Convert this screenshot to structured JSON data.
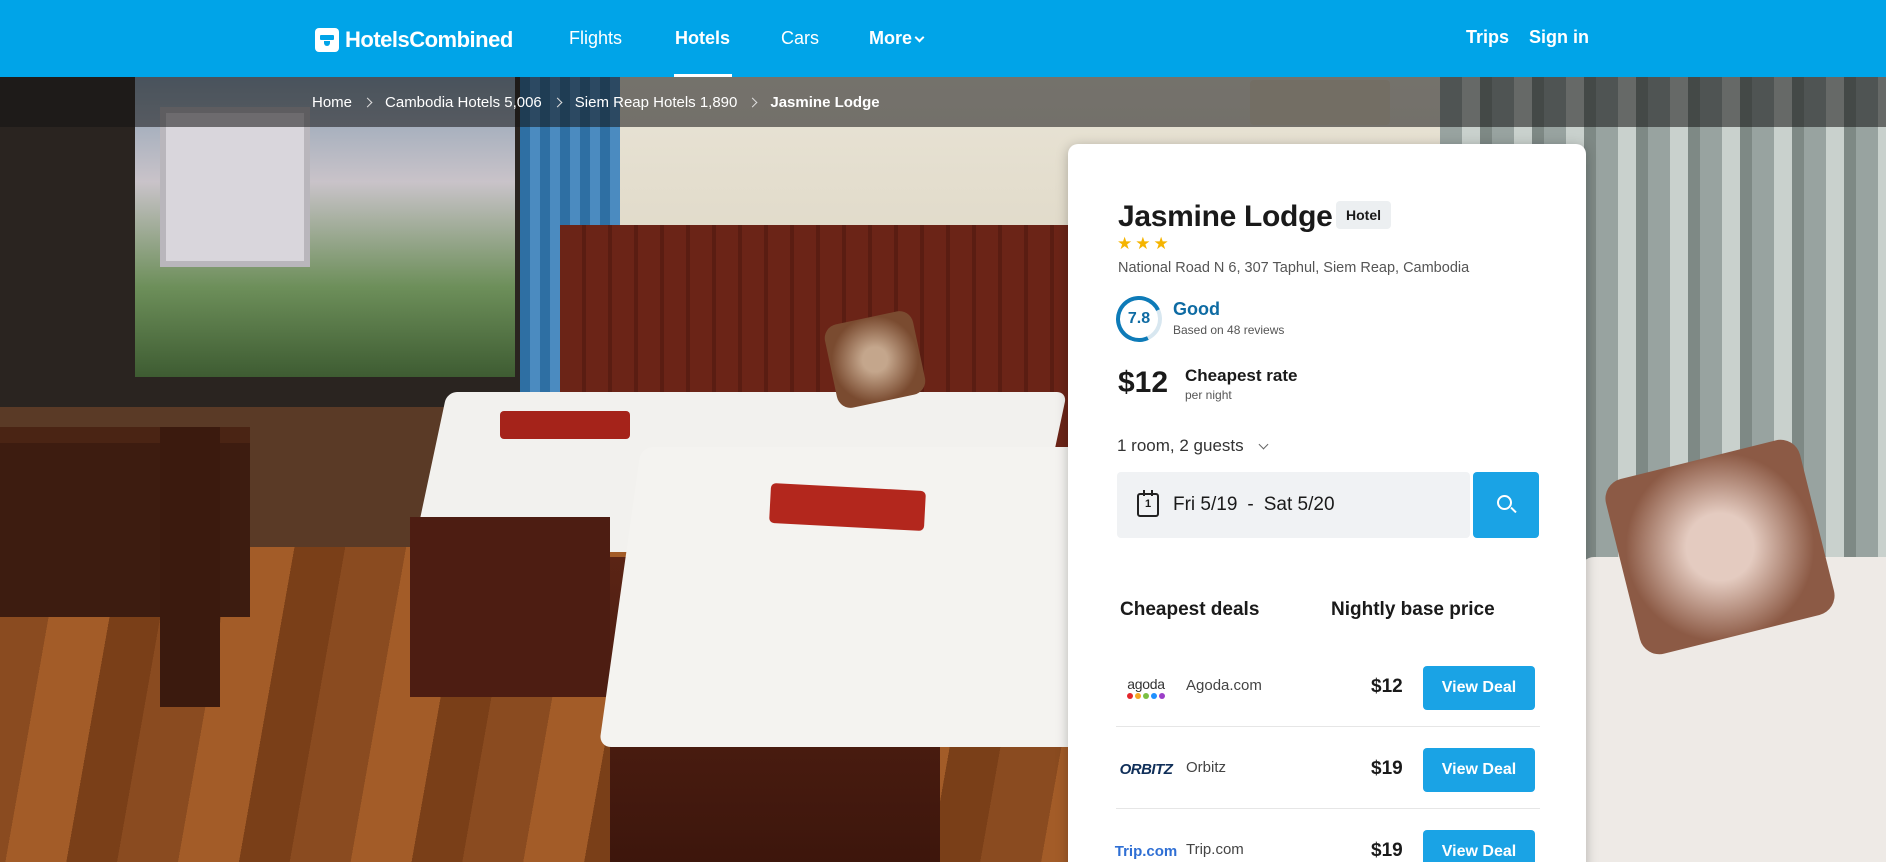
{
  "header": {
    "brand": "HotelsCombined",
    "nav": {
      "flights": "Flights",
      "hotels": "Hotels",
      "cars": "Cars",
      "more": "More"
    },
    "trips": "Trips",
    "sign_in": "Sign in",
    "accent_color": "#00a4e8"
  },
  "breadcrumb": [
    {
      "label": "Home"
    },
    {
      "label": "Cambodia Hotels 5,006"
    },
    {
      "label": "Siem Reap Hotels 1,890"
    },
    {
      "label": "Jasmine Lodge"
    }
  ],
  "hotel": {
    "name": "Jasmine Lodge",
    "type_badge": "Hotel",
    "stars": 3,
    "stars_glyphs": "★★★",
    "address": "National Road N 6, 307 Taphul, Siem Reap, Cambodia",
    "rating": {
      "score": "7.8",
      "label": "Good",
      "reviews": "Based on 48 reviews"
    },
    "cheapest": {
      "price": "$12",
      "label": "Cheapest rate",
      "sub": "per night"
    }
  },
  "search": {
    "guests": "1 room, 2 guests",
    "calendar_day": "1",
    "checkin": "Fri 5/19",
    "separator": "-",
    "checkout": "Sat 5/20",
    "button_icon": "search-icon"
  },
  "deals": {
    "header_left": "Cheapest deals",
    "header_right": "Nightly base price",
    "rows": [
      {
        "logo": "agoda",
        "provider": "Agoda.com",
        "price": "$12",
        "cta": "View Deal"
      },
      {
        "logo": "ORBITZ",
        "provider": "Orbitz",
        "price": "$19",
        "cta": "View Deal"
      },
      {
        "logo": "Trip.com",
        "provider": "Trip.com",
        "price": "$19",
        "cta": "View Deal"
      }
    ]
  }
}
